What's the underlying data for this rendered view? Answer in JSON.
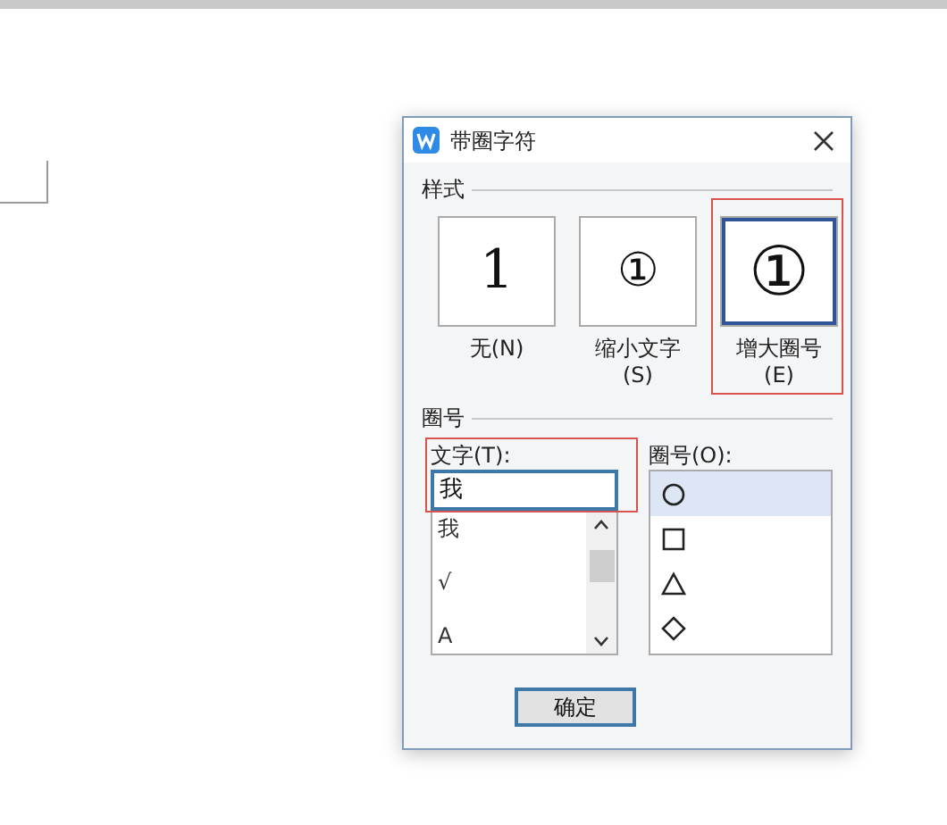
{
  "dialog": {
    "title": "带圈字符"
  },
  "style_section": {
    "label": "样式",
    "options": [
      {
        "glyph": "1",
        "label": "无(N)",
        "kind": "plain",
        "selected": false,
        "annotated": false
      },
      {
        "glyph": "①",
        "label": "缩小文字(S)",
        "kind": "small",
        "selected": false,
        "annotated": false
      },
      {
        "glyph": "①",
        "label": "增大圈号(E)",
        "kind": "large",
        "selected": true,
        "annotated": true
      }
    ]
  },
  "enclosure_section": {
    "label": "圈号",
    "text_field": {
      "label": "文字(T):",
      "value": "我",
      "annotated": true,
      "items": [
        "我",
        "√",
        "A"
      ]
    },
    "enclosure_list": {
      "label": "圈号(O):",
      "items": [
        {
          "kind": "circle",
          "selected": true
        },
        {
          "kind": "square",
          "selected": false
        },
        {
          "kind": "triangle",
          "selected": false
        },
        {
          "kind": "diamond",
          "selected": false
        }
      ]
    }
  },
  "buttons": [
    "确定"
  ]
}
